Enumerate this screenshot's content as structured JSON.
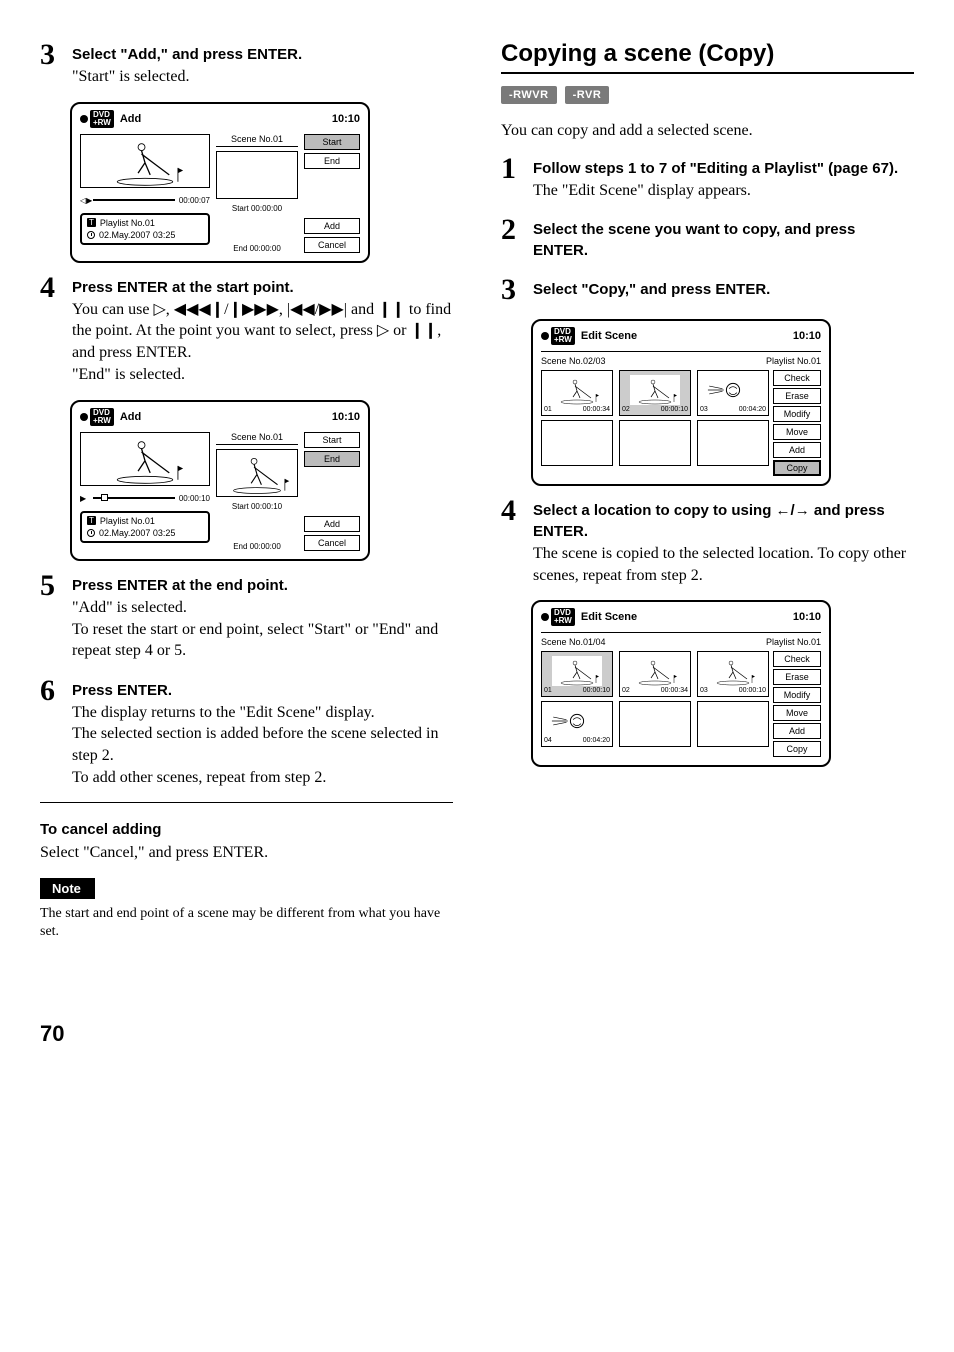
{
  "left": {
    "step3": {
      "num": "3",
      "head": "Select \"Add,\" and press ENTER.",
      "text": "\"Start\" is selected."
    },
    "screenA": {
      "title": "Add",
      "clock": "10:10",
      "sceneLabel": "Scene No.01",
      "startTime": "Start 00:00:00",
      "endTime": "End  00:00:00",
      "timelinePos": "00:00:07",
      "playlist": "Playlist No.01",
      "date": "02.May.2007  03:25",
      "btns": {
        "start": "Start",
        "end": "End",
        "add": "Add",
        "cancel": "Cancel"
      }
    },
    "step4": {
      "num": "4",
      "head": "Press ENTER at the start point.",
      "text1": "You can use ",
      "text2": " and ",
      "text3": " to find the point. At the point you want to select, press ",
      "text4": " or ",
      "text5": ", and press ENTER.",
      "text6": "\"End\" is selected."
    },
    "screenB": {
      "title": "Add",
      "clock": "10:10",
      "sceneLabel": "Scene No.01",
      "startTime": "Start 00:00:10",
      "endTime": "End  00:00:00",
      "timelinePos": "00:00:10",
      "playlist": "Playlist No.01",
      "date": "02.May.2007  03:25",
      "btns": {
        "start": "Start",
        "end": "End",
        "add": "Add",
        "cancel": "Cancel"
      }
    },
    "step5": {
      "num": "5",
      "head": "Press ENTER at the end point.",
      "text": "\"Add\" is selected.\nTo reset the start or end point, select \"Start\" or \"End\" and repeat step 4 or 5."
    },
    "step6": {
      "num": "6",
      "head": "Press ENTER.",
      "text": "The display returns to the \"Edit Scene\" display.\nThe selected section is added before the scene selected in step 2.\nTo add other scenes, repeat from step 2."
    },
    "cancelHead": "To cancel adding",
    "cancelText": "Select \"Cancel,\" and press ENTER.",
    "noteLabel": "Note",
    "noteText": "The start and end point of a scene may be different from what you have set."
  },
  "right": {
    "title": "Copying a scene (Copy)",
    "tag1": "-RWVR",
    "tag2": "-RVR",
    "intro": "You can copy and add a selected scene.",
    "step1": {
      "num": "1",
      "head": "Follow steps 1 to 7 of \"Editing a Playlist\" (page 67).",
      "text": "The \"Edit Scene\" display appears."
    },
    "step2": {
      "num": "2",
      "head": "Select the scene you want to copy, and press ENTER."
    },
    "step3": {
      "num": "3",
      "head": "Select \"Copy,\" and press ENTER."
    },
    "screenC": {
      "title": "Edit Scene",
      "clock": "10:10",
      "sceneCount": "Scene No.02/03",
      "playlist": "Playlist No.01",
      "cells": [
        {
          "n": "01",
          "t": "00:00:34"
        },
        {
          "n": "02",
          "t": "00:00:10"
        },
        {
          "n": "03",
          "t": "00:04:20"
        }
      ],
      "btns": [
        "Check",
        "Erase",
        "Modify",
        "Move",
        "Add",
        "Copy"
      ]
    },
    "step4": {
      "num": "4",
      "headA": "Select a location to copy to using ",
      "headB": " and press ENTER.",
      "text": "The scene is copied to the selected location. To copy other scenes, repeat from step 2."
    },
    "screenD": {
      "title": "Edit Scene",
      "clock": "10:10",
      "sceneCount": "Scene No.01/04",
      "playlist": "Playlist No.01",
      "cellsRow1": [
        {
          "n": "01",
          "t": "00:00:10"
        },
        {
          "n": "02",
          "t": "00:00:34"
        },
        {
          "n": "03",
          "t": "00:00:10"
        }
      ],
      "cellsRow2": [
        {
          "n": "04",
          "t": "00:04:20"
        }
      ],
      "btns": [
        "Check",
        "Erase",
        "Modify",
        "Move",
        "Add",
        "Copy"
      ]
    }
  },
  "pageNum": "70"
}
